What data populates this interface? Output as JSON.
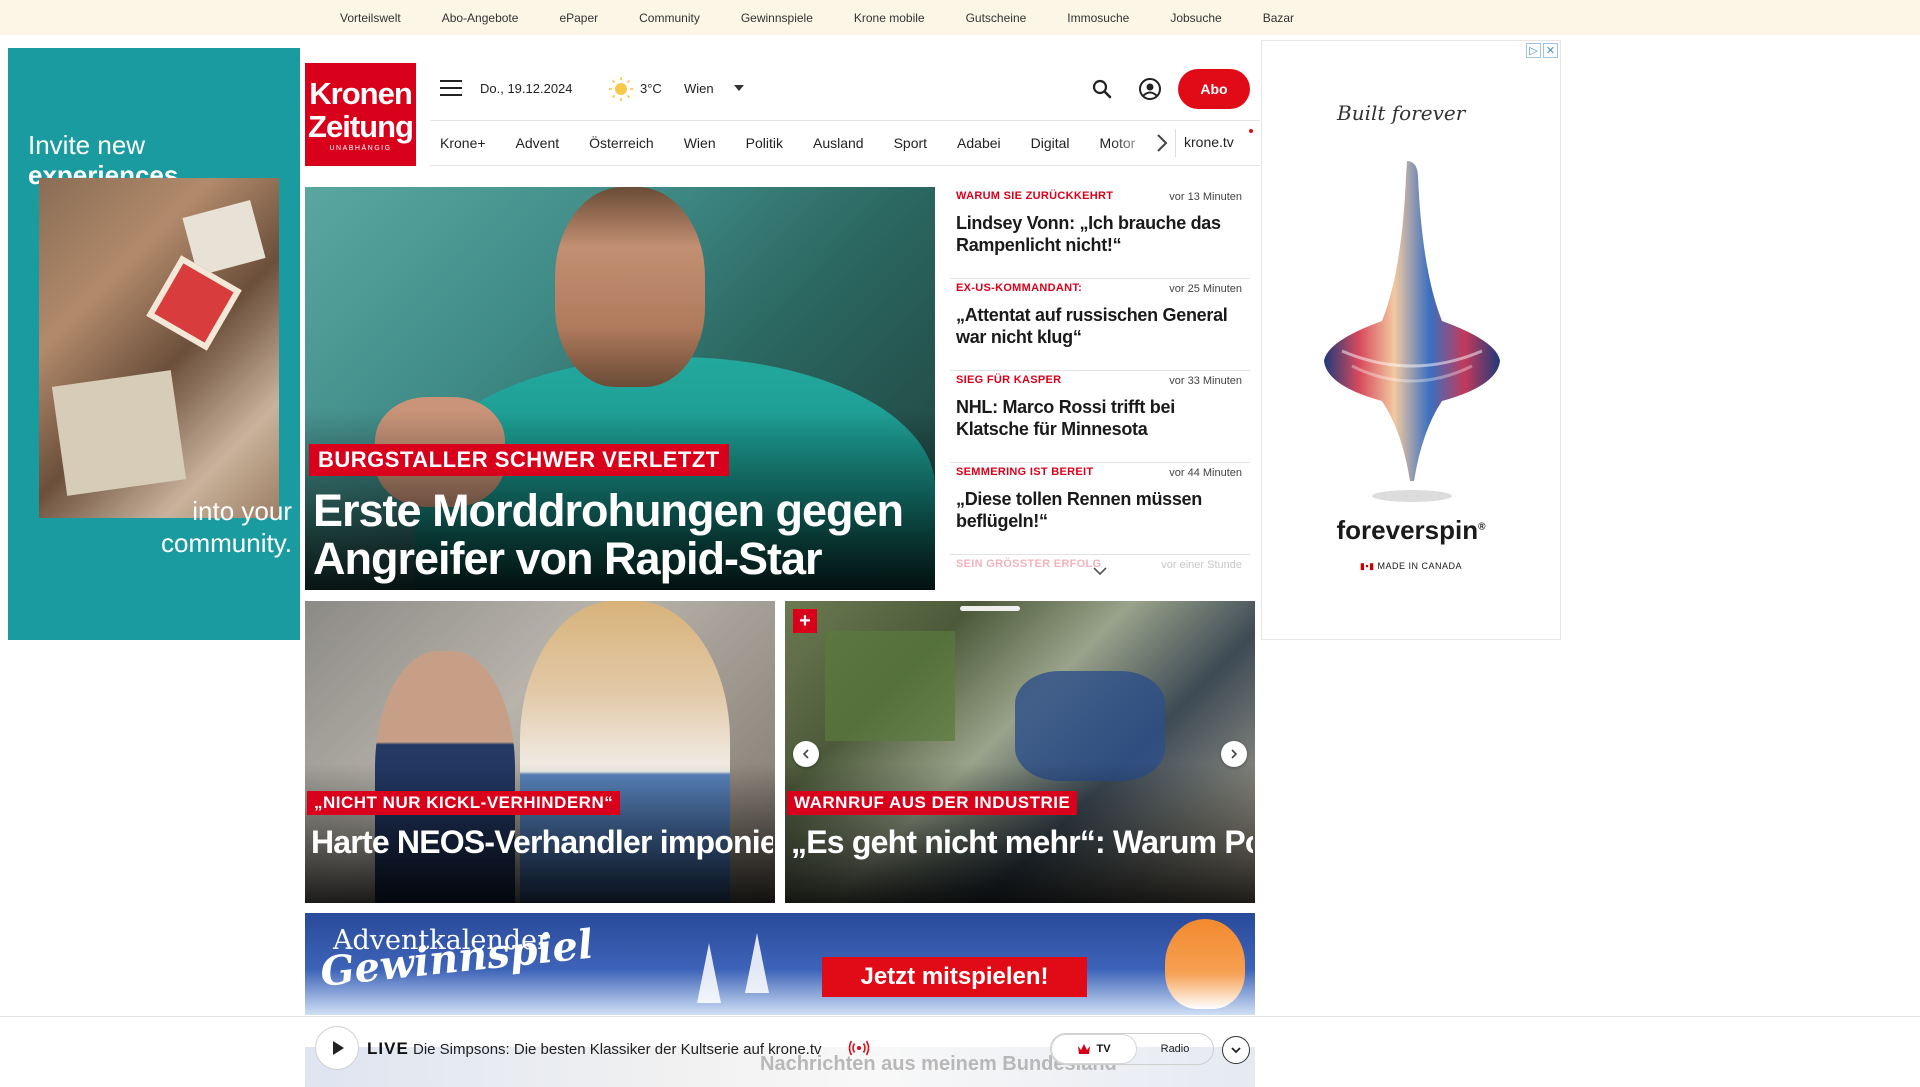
{
  "topbar": {
    "links": [
      "Vorteilswelt",
      "Abo-Angebote",
      "ePaper",
      "Community",
      "Gewinnspiele",
      "Krone mobile",
      "Gutscheine",
      "Immosuche",
      "Jobsuche",
      "Bazar"
    ]
  },
  "left_ad": {
    "line1": "Invite new",
    "line2": "experiences",
    "line3": "into your",
    "line4": "community."
  },
  "right_ad": {
    "script_text": "Built forever",
    "brand": "foreverspin",
    "brand_mark": "®",
    "made_in": "MADE IN CANADA"
  },
  "logo": {
    "line1": "Kronen",
    "line2": "Zeitung",
    "tagline": "UNABHÄNGIG"
  },
  "header": {
    "date": "Do., 19.12.2024",
    "temperature": "3°C",
    "city": "Wien",
    "abo_label": "Abo",
    "accent_color": "#e10b17"
  },
  "nav": {
    "items": [
      "Krone+",
      "Advent",
      "Österreich",
      "Wien",
      "Politik",
      "Ausland",
      "Sport",
      "Adabei",
      "Digital",
      "Motor"
    ],
    "tv_label": "krone.tv"
  },
  "hero": {
    "kicker": "BURGSTALLER SCHWER VERLETZT",
    "headline": "Erste Morddrohungen gegen Angreifer von Rapid-Star"
  },
  "news": [
    {
      "kicker": "WARUM SIE ZURÜCKKEHRT",
      "time": "vor 13 Minuten",
      "title": "Lindsey Vonn: „Ich brauche das Rampenlicht nicht!“"
    },
    {
      "kicker": "EX-US-KOMMANDANT:",
      "time": "vor 25 Minuten",
      "title": "„Attentat auf russischen General war nicht klug“"
    },
    {
      "kicker": "SIEG FÜR KASPER",
      "time": "vor 33 Minuten",
      "title": "NHL: Marco Rossi trifft bei Klatsche für Minnesota"
    },
    {
      "kicker": "SEMMERING IST BEREIT",
      "time": "vor 44 Minuten",
      "title": "„Diese tollen Rennen müssen beflügeln!“"
    },
    {
      "kicker": "SEIN GRÖSSTER ERFOLG",
      "time": "vor einer Stunde",
      "title": ""
    }
  ],
  "tiles": [
    {
      "kicker": "„NICHT NUR KICKL-VERHINDERN“",
      "headline": "Harte NEOS-Verhandler imponieren sogar VP-Granden"
    },
    {
      "kicker": "WARNRUF AUS DER INDUSTRIE",
      "headline": "„Es geht nicht mehr“: Warum Polen uns als Standort abhängt",
      "badge": "+"
    }
  ],
  "advent": {
    "title1": "Adventkalender",
    "title2": "Gewinnspiel",
    "cta": "Jetzt mitspielen!"
  },
  "live": {
    "label": "LIVE",
    "title": "Die Simpsons: Die besten Klassiker der Kultserie auf krone.tv",
    "tv": "TV",
    "radio": "Radio",
    "behind_text": "Nachrichten aus meinem Bundesland"
  }
}
